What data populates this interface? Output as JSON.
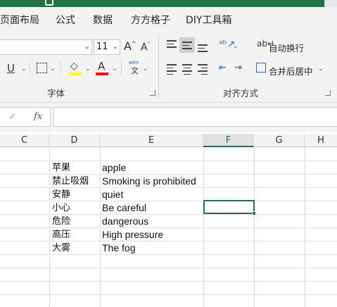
{
  "ribbon_tabs": [
    "页面布局",
    "公式",
    "数据",
    "方方格子",
    "DIY工具箱"
  ],
  "font_group": {
    "font_name": "",
    "font_size": "11",
    "label": "字体",
    "grow_icon": "font-grow-icon",
    "shrink_icon": "font-shrink-icon",
    "underline": "U",
    "font_color_letter": "A",
    "phonetic_top": "wén",
    "phonetic_bottom": "文"
  },
  "align_group": {
    "wrap_text": "自动换行",
    "merge_center": "合并后居中",
    "label": "对齐方式"
  },
  "formula_bar": {
    "cancel_symbol": "✓",
    "fx_label": "fx",
    "value": ""
  },
  "columns": [
    "C",
    "D",
    "E",
    "F",
    "G",
    "H"
  ],
  "active_column": "F",
  "rows": [
    {
      "d": "苹果",
      "e": "apple"
    },
    {
      "d": "禁止吸烟",
      "e": "Smoking is prohibited"
    },
    {
      "d": "安静",
      "e": "quiet"
    },
    {
      "d": "小心",
      "e": "Be careful"
    },
    {
      "d": "危险",
      "e": "dangerous"
    },
    {
      "d": "高压",
      "e": "High pressure"
    },
    {
      "d": "大雾",
      "e": "The fog"
    }
  ],
  "colors": {
    "accent": "#217346",
    "highlight_yellow": "#ffff00",
    "font_red": "#ff0000"
  }
}
